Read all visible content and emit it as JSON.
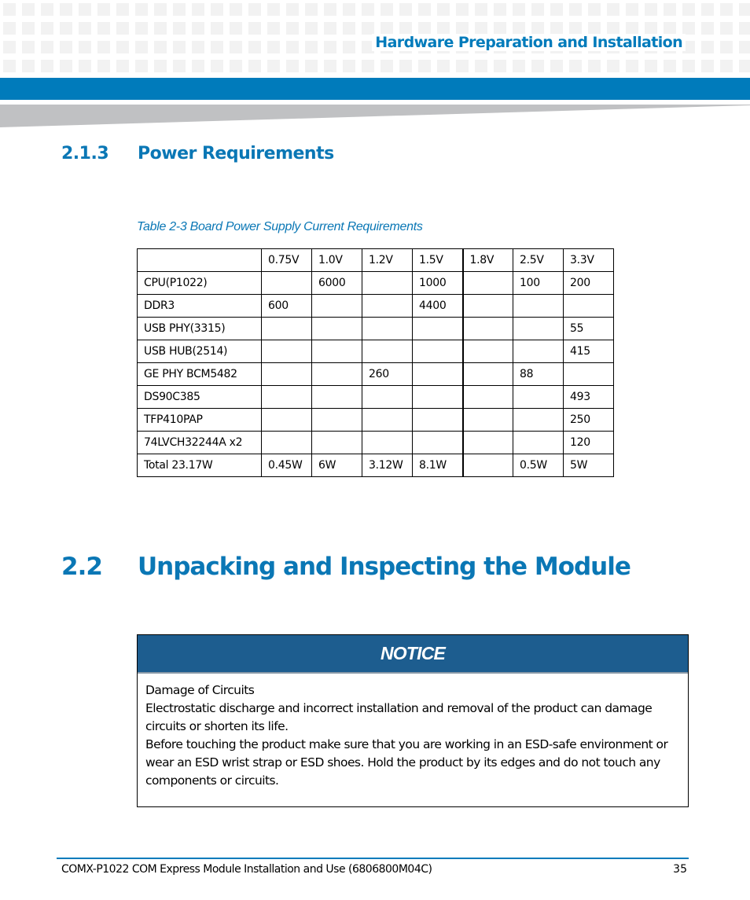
{
  "header": {
    "title": "Hardware Preparation and Installation",
    "brand_color": "#007bbb"
  },
  "section_2_1_3": {
    "number": "2.1.3",
    "title": "Power Requirements"
  },
  "table": {
    "caption": "Table 2-3 Board Power Supply Current Requirements",
    "columns": [
      "",
      "0.75V",
      "1.0V",
      "1.2V",
      "1.5V",
      "1.8V",
      "2.5V",
      "3.3V"
    ],
    "rows": [
      [
        "CPU(P1022)",
        "",
        "6000",
        "",
        "1000",
        "",
        "100",
        "200"
      ],
      [
        "DDR3",
        "600",
        "",
        "",
        "4400",
        "",
        "",
        ""
      ],
      [
        "USB PHY(3315)",
        "",
        "",
        "",
        "",
        "",
        "",
        "55"
      ],
      [
        "USB HUB(2514)",
        "",
        "",
        "",
        "",
        "",
        "",
        "415"
      ],
      [
        "GE PHY BCM5482",
        "",
        "",
        "260",
        "",
        "",
        "88",
        ""
      ],
      [
        "DS90C385",
        "",
        "",
        "",
        "",
        "",
        "",
        "493"
      ],
      [
        "TFP410PAP",
        "",
        "",
        "",
        "",
        "",
        "",
        "250"
      ],
      [
        "74LVCH32244A x2",
        "",
        "",
        "",
        "",
        "",
        "",
        "120"
      ],
      [
        "Total 23.17W",
        "0.45W",
        "6W",
        "3.12W",
        "8.1W",
        "",
        "0.5W",
        "5W"
      ]
    ]
  },
  "section_2_2": {
    "number": "2.2",
    "title": "Unpacking and Inspecting the Module"
  },
  "notice": {
    "label": "NOTICE",
    "header_color": "#1d5d8f",
    "lines": [
      "Damage of Circuits",
      "Electrostatic discharge and incorrect installation and removal of the product can damage circuits or shorten its life.",
      "Before touching the product make sure that you are working in an ESD-safe environment or wear an ESD wrist strap or ESD shoes. Hold the product by its edges and do not touch any components or circuits."
    ]
  },
  "footer": {
    "document_title": "COMX-P1022 COM Express Module Installation and Use (6806800M04C)",
    "page_number": "35"
  }
}
